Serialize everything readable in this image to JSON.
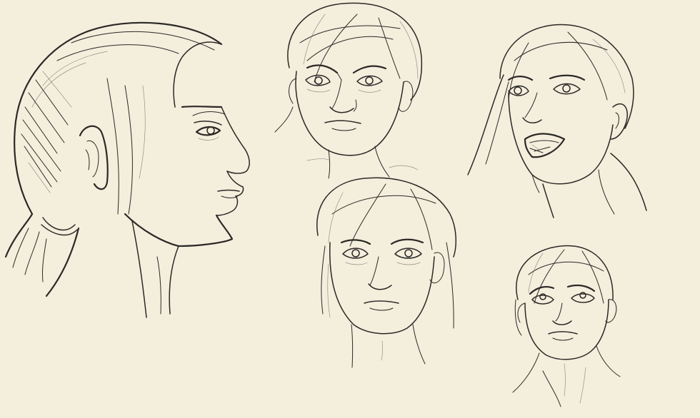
{
  "palette": {
    "paper": "#f4eedd",
    "ink": "#2b2926",
    "shade": "#6d6a64"
  },
  "sketches": [
    {
      "id": "profile-left",
      "subject": "woman-head-profile"
    },
    {
      "id": "frown-front",
      "subject": "woman-head-frowning"
    },
    {
      "id": "shout-three-quarter",
      "subject": "woman-head-shouting"
    },
    {
      "id": "neutral-front",
      "subject": "woman-head-neutral"
    },
    {
      "id": "look-up",
      "subject": "woman-head-looking-up"
    }
  ]
}
